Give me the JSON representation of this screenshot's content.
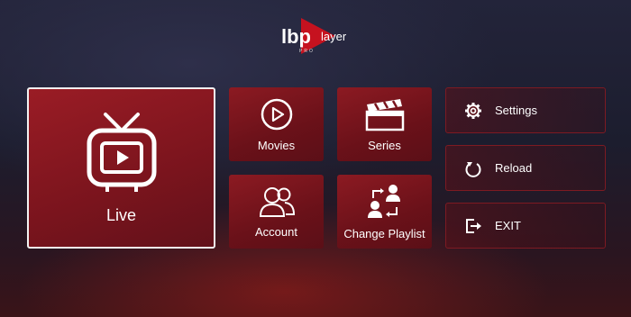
{
  "logo": {
    "brand_text_1": "lbp",
    "brand_text_2": "layer",
    "subtext": "PRO"
  },
  "tiles": {
    "live": "Live",
    "movies": "Movies",
    "series": "Series",
    "account": "Account",
    "change_playlist": "Change Playlist"
  },
  "side_menu": {
    "settings": "Settings",
    "reload": "Reload",
    "exit": "EXIT"
  },
  "colors": {
    "tile_red": "#7a141d",
    "accent": "#c6121f",
    "border": "#f2f2f2"
  }
}
